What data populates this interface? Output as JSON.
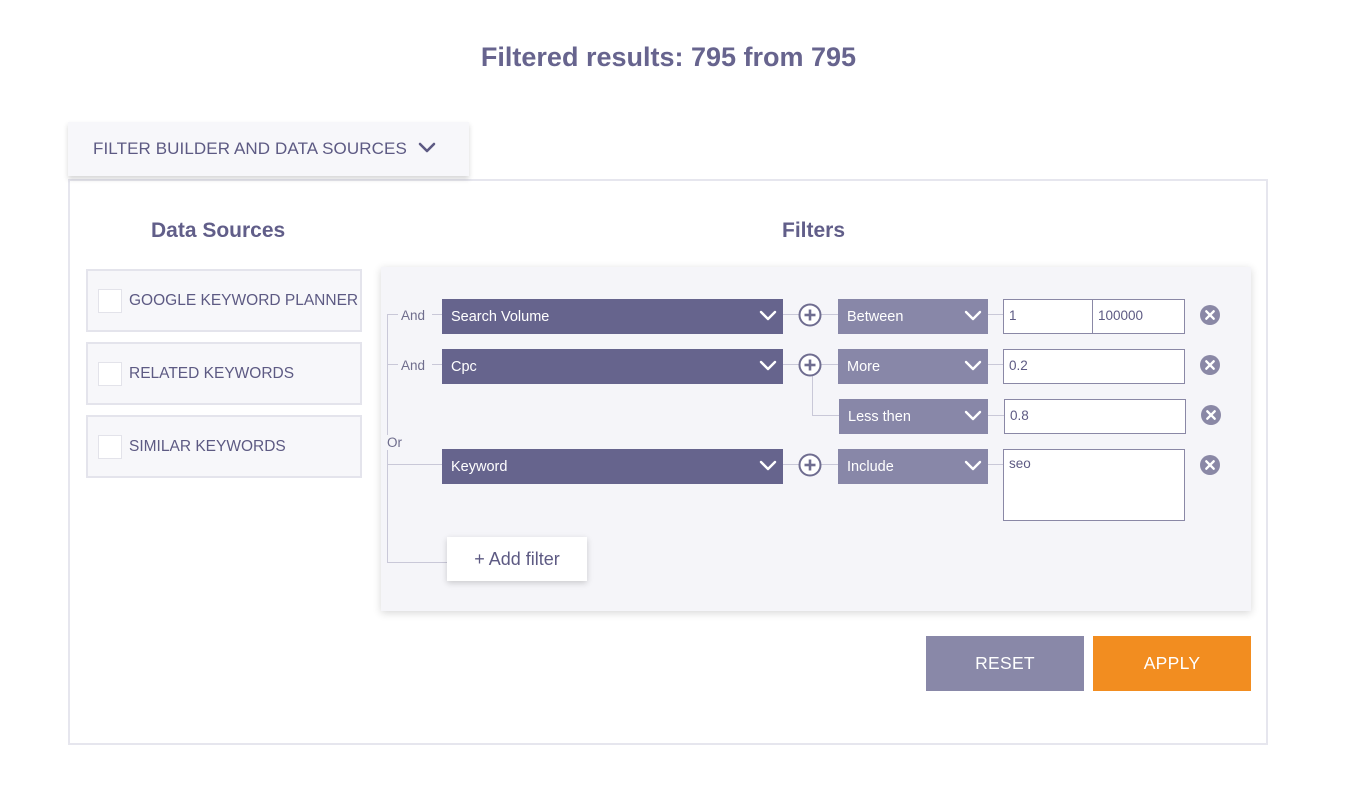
{
  "header": {
    "results_title": "Filtered results: 795 from 795"
  },
  "builder_tab": {
    "label": "FILTER BUILDER AND DATA SOURCES",
    "icon": "chevron-down-icon"
  },
  "data_sources": {
    "title": "Data Sources",
    "items": [
      {
        "label": "GOOGLE KEYWORD PLANNER",
        "checked": false
      },
      {
        "label": "RELATED KEYWORDS",
        "checked": false
      },
      {
        "label": "SIMILAR KEYWORDS",
        "checked": false
      }
    ]
  },
  "filters": {
    "title": "Filters",
    "connectors": {
      "and_1": "And",
      "and_2": "And",
      "or": "Or"
    },
    "rows": [
      {
        "field": "Search Volume",
        "operator": "Between",
        "value_min": "1",
        "value_max": "100000"
      },
      {
        "field": "Cpc",
        "operator": "More",
        "value": "0.2"
      },
      {
        "operator": "Less then",
        "value": "0.8"
      },
      {
        "field": "Keyword",
        "operator": "Include",
        "value": "seo"
      }
    ],
    "add_filter_label": "+ Add filter"
  },
  "actions": {
    "reset_label": "RESET",
    "apply_label": "APPLY"
  },
  "colors": {
    "title": "#67648e",
    "field_select": "#66648d",
    "operator_select": "#8887a8",
    "reset": "#8988a8",
    "apply": "#f28d20",
    "icon": "#8a88a6"
  }
}
